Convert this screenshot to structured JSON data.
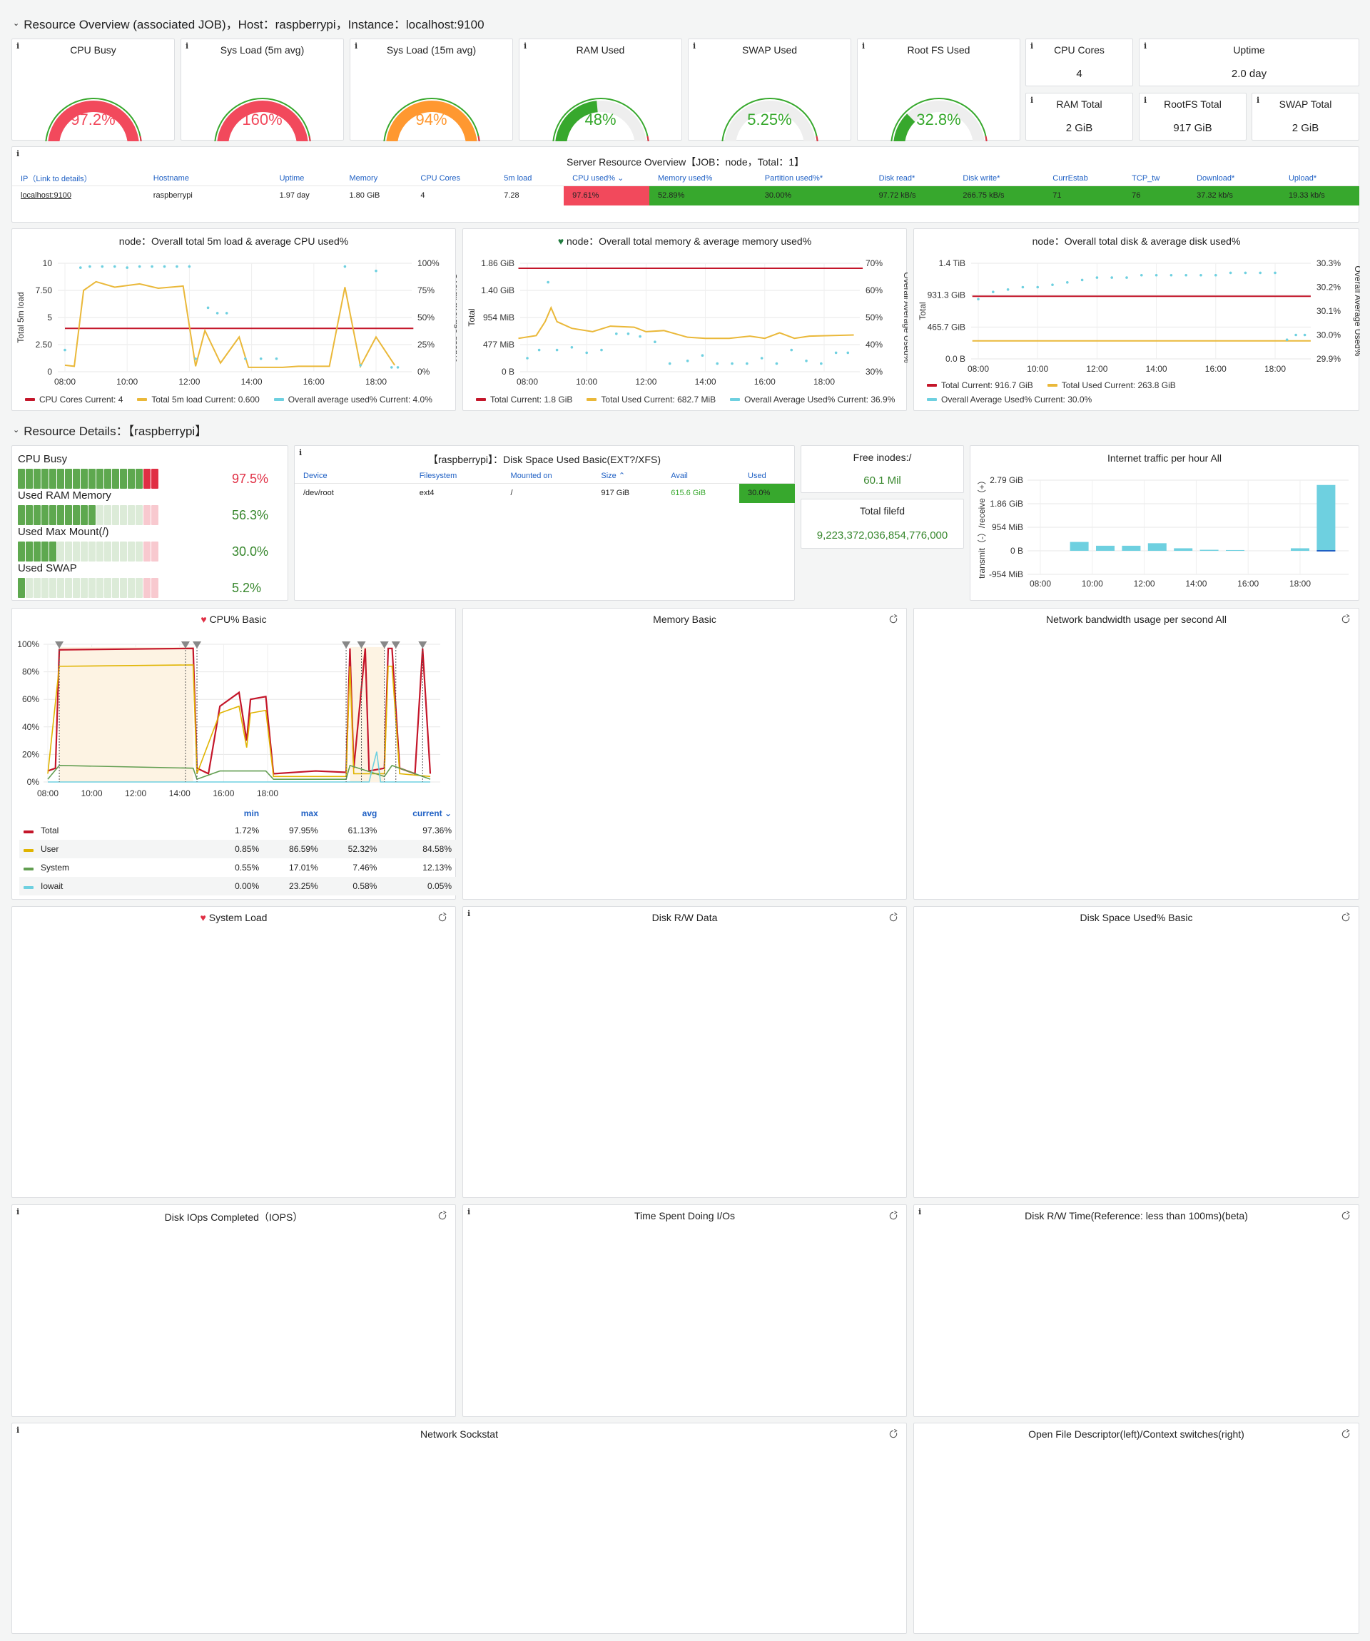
{
  "row1": {
    "title": "Resource Overview (associated JOB)，Host：raspberrypi，Instance：localhost:9100"
  },
  "gauges": [
    {
      "title": "CPU Busy",
      "value": "97.2%",
      "pct": 0.972,
      "color": "#f2495c"
    },
    {
      "title": "Sys Load (5m avg)",
      "value": "160%",
      "pct": 1.0,
      "color": "#f2495c"
    },
    {
      "title": "Sys Load (15m avg)",
      "value": "94%",
      "pct": 0.94,
      "color": "#ff9830"
    },
    {
      "title": "RAM Used",
      "value": "48%",
      "pct": 0.48,
      "color": "#37a82d"
    },
    {
      "title": "SWAP Used",
      "value": "5.25%",
      "pct": 0.0525,
      "color": "#37a82d"
    },
    {
      "title": "Root FS Used",
      "value": "32.8%",
      "pct": 0.328,
      "color": "#37a82d"
    }
  ],
  "stats": {
    "cpu_cores": {
      "title": "CPU Cores",
      "value": "4"
    },
    "uptime": {
      "title": "Uptime",
      "value": "2.0 day"
    },
    "ram_total": {
      "title": "RAM Total",
      "value": "2 GiB"
    },
    "rootfs_total": {
      "title": "RootFS Total",
      "value": "917 GiB"
    },
    "swap_total": {
      "title": "SWAP Total",
      "value": "2 GiB"
    }
  },
  "server_table": {
    "title": "Server Resource Overview【JOB：node，Total：1】",
    "headers": [
      "IP（Link to details）",
      "Hostname",
      "Uptime",
      "Memory",
      "CPU Cores",
      "5m load",
      "CPU used%",
      "Memory used%",
      "Partition used%*",
      "Disk read*",
      "Disk write*",
      "CurrEstab",
      "TCP_tw",
      "Download*",
      "Upload*"
    ],
    "row": [
      "localhost:9100",
      "raspberrypi",
      "1.97 day",
      "1.80 GiB",
      "4",
      "7.28",
      "97.61%",
      "52.89%",
      "30.00%",
      "97.72 kB/s",
      "266.75 kB/s",
      "71",
      "76",
      "37.32 kb/s",
      "19.33 kb/s"
    ]
  },
  "chart_cpu_load": {
    "title": "node：Overall total 5m load & average CPU used%",
    "legend": [
      "CPU Cores  Current: 4",
      "Total 5m load  Current: 0.600",
      "Overall average used%  Current: 4.0%"
    ],
    "ylabel_left": "Total 5m load",
    "ylabel_right": "Overall average used%",
    "yticks_left": [
      "10",
      "7.50",
      "5",
      "2.50",
      "0"
    ],
    "yticks_right": [
      "100%",
      "75%",
      "50%",
      "25%",
      "0%"
    ],
    "xticks": [
      "08:00",
      "10:00",
      "12:00",
      "14:00",
      "16:00",
      "18:00"
    ]
  },
  "chart_mem": {
    "title": "node：Overall total memory & average memory used%",
    "legend": [
      "Total  Current: 1.8 GiB",
      "Total Used  Current: 682.7 MiB",
      "Overall Average Used%  Current: 36.9%"
    ],
    "ylabel_left": "Total",
    "ylabel_right": "Overall Average Used%",
    "yticks_left": [
      "1.86 GiB",
      "1.40 GiB",
      "954 MiB",
      "477 MiB",
      "0 B"
    ],
    "yticks_right": [
      "70%",
      "60%",
      "50%",
      "40%",
      "30%"
    ],
    "xticks": [
      "08:00",
      "10:00",
      "12:00",
      "14:00",
      "16:00",
      "18:00"
    ]
  },
  "chart_disk": {
    "title": "node：Overall total disk & average disk used%",
    "legend": [
      "Total  Current: 916.7 GiB",
      "Total Used  Current: 263.8 GiB",
      "Overall Average Used%  Current: 30.0%"
    ],
    "ylabel_left": "Total",
    "ylabel_right": "Overall Average Used%",
    "yticks_left": [
      "1.4 TiB",
      "931.3 GiB",
      "465.7 GiB",
      "0.0 B"
    ],
    "yticks_right": [
      "30.3%",
      "30.2%",
      "30.1%",
      "30.0%",
      "29.9%"
    ],
    "xticks": [
      "08:00",
      "10:00",
      "12:00",
      "14:00",
      "16:00",
      "18:00"
    ]
  },
  "row2": {
    "title": "Resource Details：【raspberrypi】"
  },
  "bar_gauges": [
    {
      "label": "CPU Busy",
      "value": "97.5%",
      "pct": 0.975,
      "color": "#e02f44"
    },
    {
      "label": "Used RAM Memory",
      "value": "56.3%",
      "pct": 0.563,
      "color": "#37872d"
    },
    {
      "label": "Used Max Mount(/)",
      "value": "30.0%",
      "pct": 0.3,
      "color": "#37872d"
    },
    {
      "label": "Used SWAP",
      "value": "5.2%",
      "pct": 0.052,
      "color": "#37872d"
    }
  ],
  "disk_table": {
    "title": "【raspberrypi】：Disk Space Used Basic(EXT?/XFS)",
    "headers": [
      "Device",
      "Filesystem",
      "Mounted on",
      "Size",
      "Avail",
      "Used"
    ],
    "row": [
      "/dev/root",
      "ext4",
      "/",
      "917 GiB",
      "615.6 GiB",
      "30.0%"
    ]
  },
  "free_inodes": {
    "title": "Free inodes:/",
    "value": "60.1 Mil"
  },
  "total_filefd": {
    "title": "Total filefd",
    "value": "9,223,372,036,854,776,000"
  },
  "traffic": {
    "title": "Internet traffic per hour All",
    "ylabel": "transmit（-）/receive（+）",
    "yticks": [
      "2.79 GiB",
      "1.86 GiB",
      "954 MiB",
      "0 B",
      "-954 MiB"
    ],
    "xticks": [
      "08:00",
      "10:00",
      "12:00",
      "14:00",
      "16:00",
      "18:00"
    ]
  },
  "cpu_basic": {
    "title": "CPU% Basic",
    "yticks": [
      "100%",
      "80%",
      "60%",
      "40%",
      "20%",
      "0%"
    ],
    "xticks": [
      "08:00",
      "10:00",
      "12:00",
      "14:00",
      "16:00",
      "18:00"
    ],
    "legend_headers": [
      "min",
      "max",
      "avg",
      "current"
    ],
    "legend_rows": [
      {
        "name": "Total",
        "min": "1.72%",
        "max": "97.95%",
        "avg": "61.13%",
        "current": "97.36%",
        "color": "#c4162a"
      },
      {
        "name": "User",
        "min": "0.85%",
        "max": "86.59%",
        "avg": "52.32%",
        "current": "84.58%",
        "color": "#e0b400"
      },
      {
        "name": "System",
        "min": "0.55%",
        "max": "17.01%",
        "avg": "7.46%",
        "current": "12.13%",
        "color": "#629e51"
      },
      {
        "name": "Iowait",
        "min": "0.00%",
        "max": "23.25%",
        "avg": "0.58%",
        "current": "0.05%",
        "color": "#6ed0e0"
      }
    ]
  },
  "empty_panels": {
    "memory_basic": "Memory Basic",
    "network_bandwidth": "Network bandwidth usage per second All",
    "system_load": "System Load",
    "disk_rw_data": "Disk R/W Data",
    "disk_space_used": "Disk Space Used% Basic",
    "disk_iops": "Disk IOps Completed（IOPS）",
    "time_spent_io": "Time Spent Doing I/Os",
    "disk_rw_time": "Disk R/W Time(Reference: less than 100ms)(beta)",
    "network_sockstat": "Network Sockstat",
    "open_fd": "Open File Descriptor(left)/Context switches(right)"
  }
}
